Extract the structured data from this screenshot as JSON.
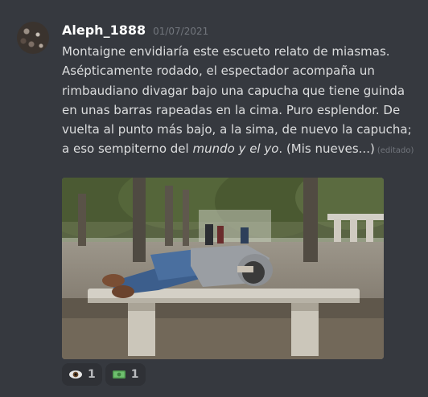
{
  "message": {
    "username": "Aleph_1888",
    "timestamp": "01/07/2021",
    "text_before_italic": "Montaigne envidiaría este escueto relato de miasmas. Asépticamente rodado, el espectador acompaña un rimbaudiano divagar bajo una capucha que tiene guinda en unas barras rapeadas en la cima. Puro esplendor. De vuelta al punto más bajo, a la sima, de nuevo la capucha; a eso sempiterno del ",
    "text_italic": "mundo y el yo",
    "text_after_italic": ". (Mis nueves...)",
    "edited_label": "(editado)"
  },
  "attachment": {
    "icon": "photo-person-on-bench"
  },
  "reactions": [
    {
      "icon": "eye-icon",
      "count": "1"
    },
    {
      "icon": "money-icon",
      "count": "1"
    }
  ],
  "colors": {
    "background": "#36393f",
    "username": "#ffffff",
    "text": "#dcddde",
    "muted": "#72767d",
    "reaction_bg": "#2f3136"
  }
}
